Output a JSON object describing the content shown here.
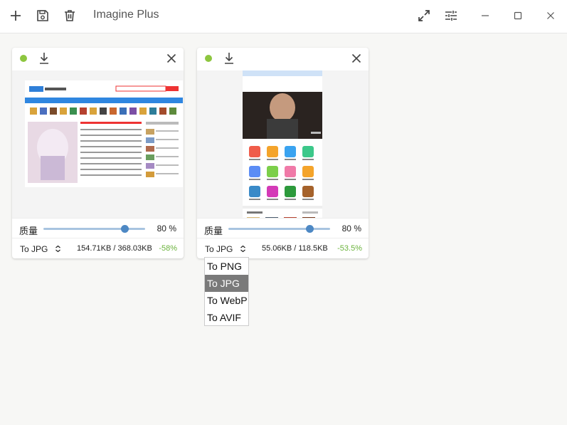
{
  "app": {
    "title": "Imagine Plus",
    "icons": {
      "add": "plus-icon",
      "save": "save-icon",
      "delete": "trash-icon",
      "fullscreen": "expand-icon",
      "settings": "sliders-icon",
      "minimize": "minimize-icon",
      "maximize": "maximize-icon",
      "close": "close-icon"
    }
  },
  "cards": [
    {
      "status_color": "#8dc63f",
      "quality_label": "质量",
      "quality_value": "80",
      "quality_unit": "%",
      "quality": 0.8,
      "format_label": "To JPG",
      "sizes": "154.71KB / 368.03KB",
      "saving": "-58%"
    },
    {
      "status_color": "#8dc63f",
      "quality_label": "质量",
      "quality_value": "80",
      "quality_unit": "%",
      "quality": 0.8,
      "format_label": "To JPG",
      "sizes": "55.06KB / 118.5KB",
      "saving": "-53.5%"
    }
  ],
  "format_dropdown": {
    "options": [
      "To PNG",
      "To JPG",
      "To WebP",
      "To AVIF"
    ],
    "selected": "To JPG"
  },
  "colors": {
    "accent": "#4d88c4",
    "saving": "#6bb33d",
    "selected_option": "#7a7a7a"
  }
}
